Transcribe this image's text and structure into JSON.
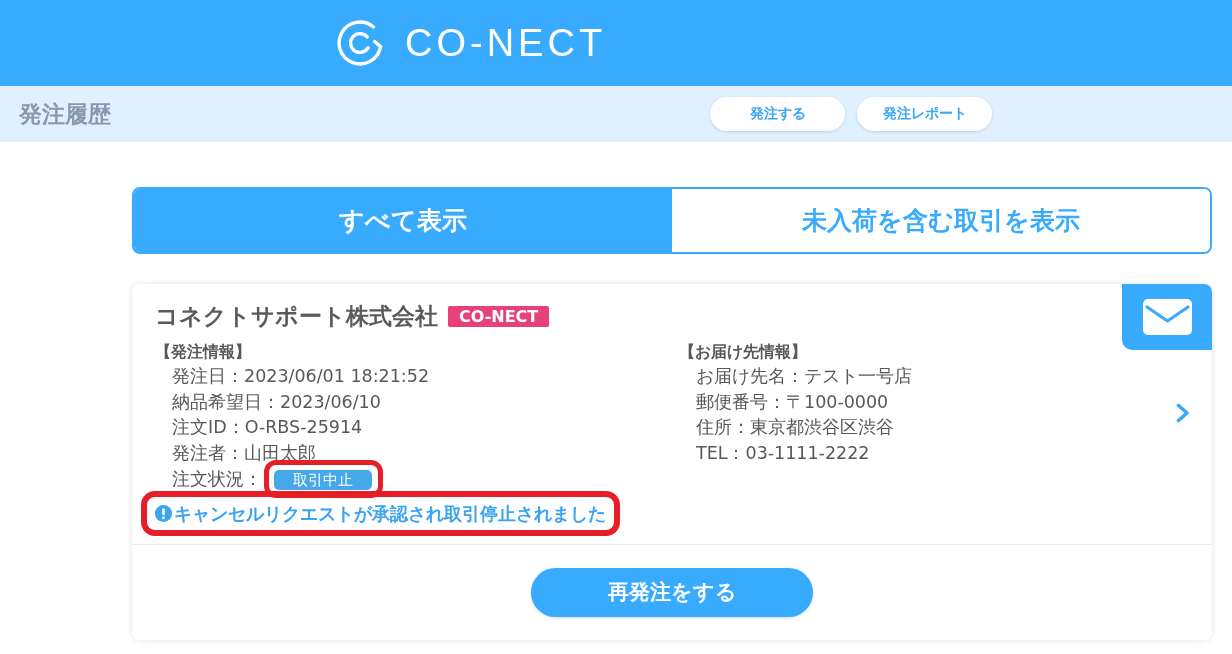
{
  "header": {
    "logo_text": "CO-NECT"
  },
  "page_title": "発注履歴",
  "actions": [
    {
      "label": "発注する"
    },
    {
      "label": "発注レポート"
    }
  ],
  "filter_tabs": [
    {
      "label": "すべて表示",
      "selected": true
    },
    {
      "label": "未入荷を含む取引を表示",
      "selected": false
    }
  ],
  "orders": [
    {
      "company": "コネクトサポート株式会社",
      "tag": "CO-NECT",
      "order_info": {
        "heading": "【発注情報】",
        "rows": [
          "発注日：2023/06/01 18:21:52",
          "納品希望日：2023/06/10",
          "注文ID：O-RBS-25914",
          "発注者：山田太郎"
        ],
        "status": {
          "label": "注文状況：",
          "value": "取引中止",
          "highlighted": true
        }
      },
      "notice": {
        "text": "キャンセルリクエストが承認され取引停止されました",
        "highlighted": true
      },
      "delivery_info": {
        "heading": "【お届け先情報】",
        "rows": [
          "お届け先名：テスト一号店",
          "郵便番号：〒100-0000",
          "住所：東京都渋谷区渋谷",
          "TEL：03-1111-2222"
        ]
      },
      "reorder_button": {
        "label": "再発注をする"
      }
    }
  ]
}
